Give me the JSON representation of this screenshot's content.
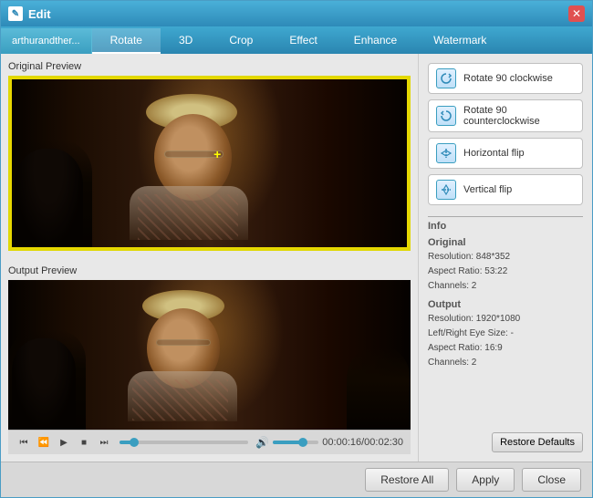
{
  "window": {
    "title": "Edit",
    "icon": "✎"
  },
  "tabs": {
    "file_tab": "arthurandther...",
    "items": [
      "Rotate",
      "3D",
      "Crop",
      "Effect",
      "Enhance",
      "Watermark"
    ],
    "active": "Rotate"
  },
  "actions": [
    {
      "id": "rotate-cw",
      "label": "Rotate 90 clockwise"
    },
    {
      "id": "rotate-ccw",
      "label": "Rotate 90 counterclockwise"
    },
    {
      "id": "flip-h",
      "label": "Horizontal flip"
    },
    {
      "id": "flip-v",
      "label": "Vertical flip"
    }
  ],
  "previews": {
    "original_label": "Original Preview",
    "output_label": "Output Preview"
  },
  "info": {
    "section_label": "Info",
    "original": {
      "label": "Original",
      "resolution": "Resolution: 848*352",
      "aspect_ratio": "Aspect Ratio: 53:22",
      "channels": "Channels: 2"
    },
    "output": {
      "label": "Output",
      "resolution": "Resolution: 1920*1080",
      "lr_eye_size": "Left/Right Eye Size: -",
      "aspect_ratio": "Aspect Ratio: 16:9",
      "channels": "Channels: 2"
    }
  },
  "playback": {
    "time": "00:00:16/00:02:30",
    "progress_percent": 11
  },
  "buttons": {
    "restore_defaults": "Restore Defaults",
    "restore_all": "Restore All",
    "apply": "Apply",
    "close": "Close"
  }
}
